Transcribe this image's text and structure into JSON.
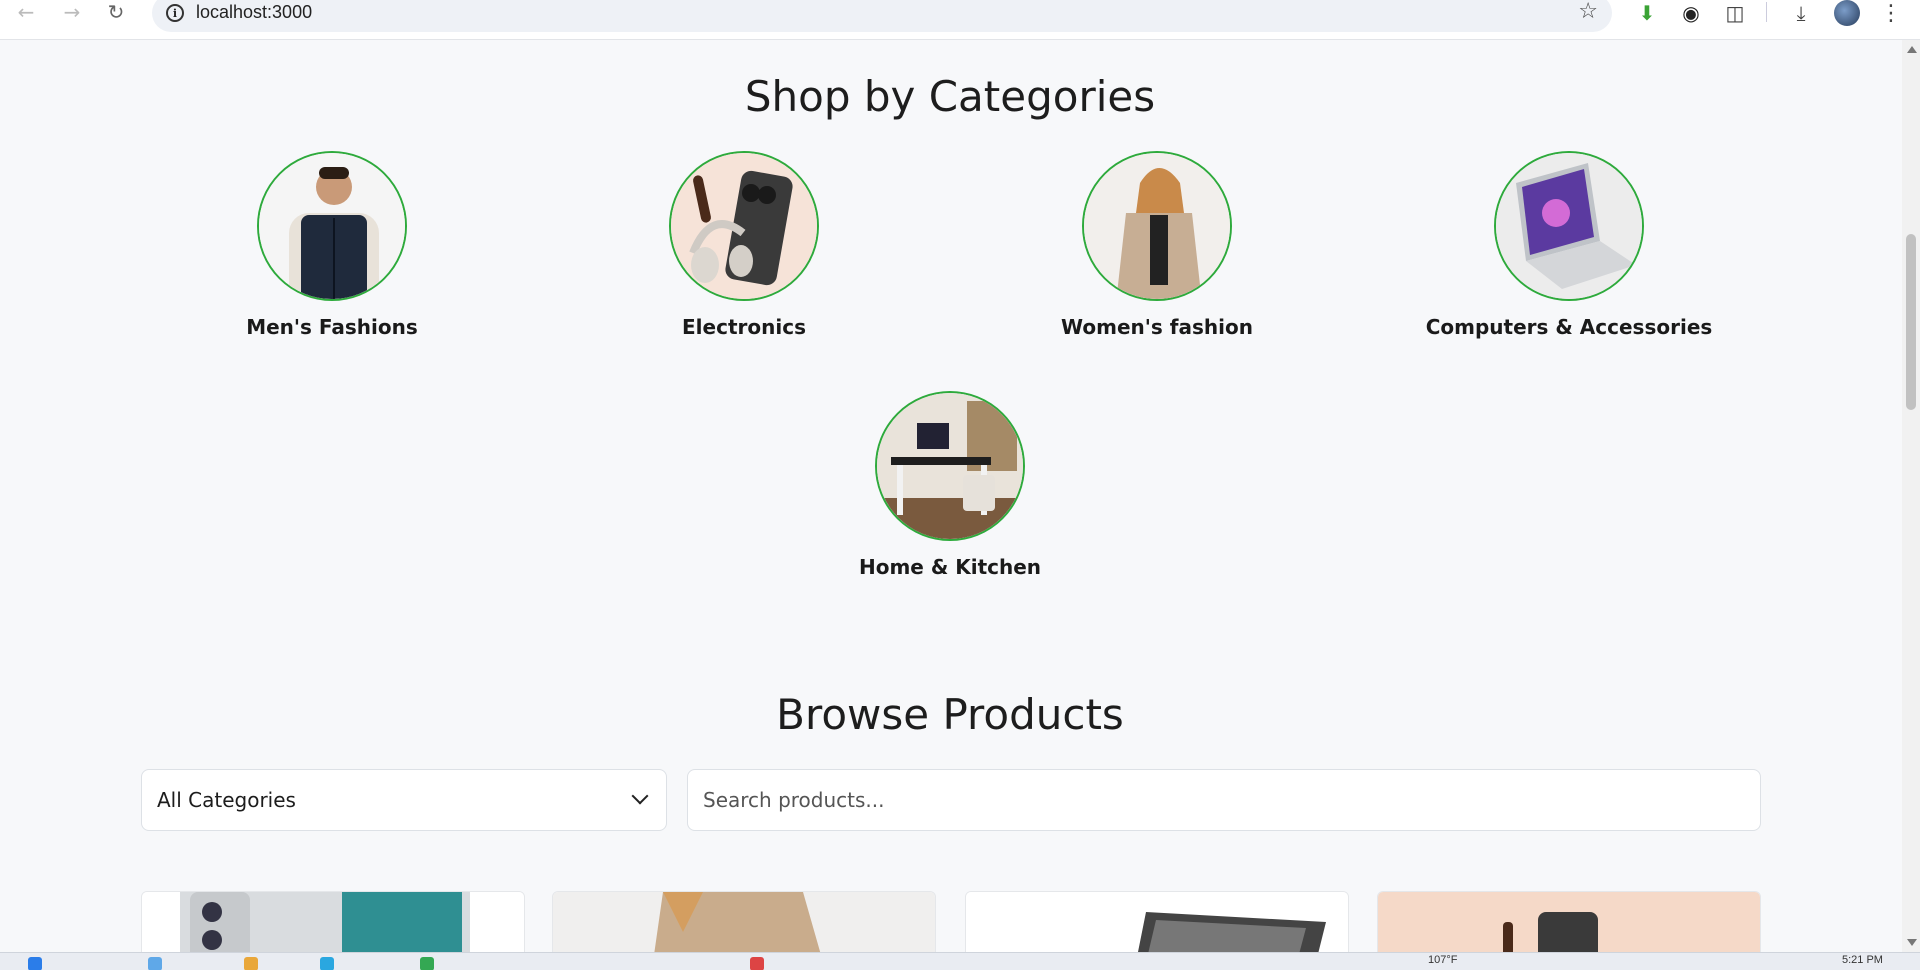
{
  "browser": {
    "url": "localhost:3000"
  },
  "categories_section": {
    "title": "Shop by Categories",
    "items": [
      {
        "label": "Men's Fashions"
      },
      {
        "label": "Electronics"
      },
      {
        "label": "Women's fashion"
      },
      {
        "label": "Computers & Accessories"
      },
      {
        "label": "Home & Kitchen"
      }
    ]
  },
  "browse_section": {
    "title": "Browse Products",
    "category_select": {
      "value": "All Categories"
    },
    "search": {
      "placeholder": "Search products..."
    }
  },
  "taskbar": {
    "weather": "107°F",
    "time": "5:21 PM"
  },
  "colors": {
    "accent_green": "#2eaa3c",
    "background": "#f7f8fa"
  }
}
